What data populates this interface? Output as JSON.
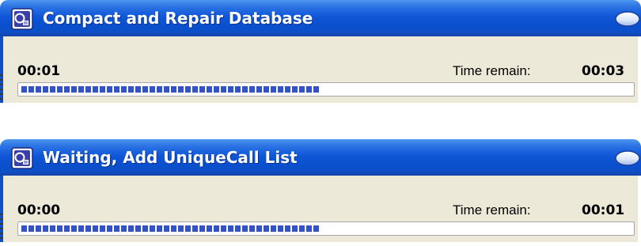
{
  "colors": {
    "title_bar": "#0c4fc8",
    "window_body": "#ece9d8",
    "progress_block": "#3253c7",
    "title_text": "#ffffff"
  },
  "windows": [
    {
      "icon": "database-app-icon",
      "title": "Compact and Repair Database",
      "elapsed": "00:01",
      "remain_label": "Time remain:",
      "remain_value": "00:03",
      "progress": 0.49
    },
    {
      "icon": "database-app-icon",
      "title": "Waiting, Add UniqueCall List",
      "elapsed": "00:00",
      "remain_label": "Time remain:",
      "remain_value": "00:01",
      "progress": 0.49
    }
  ]
}
